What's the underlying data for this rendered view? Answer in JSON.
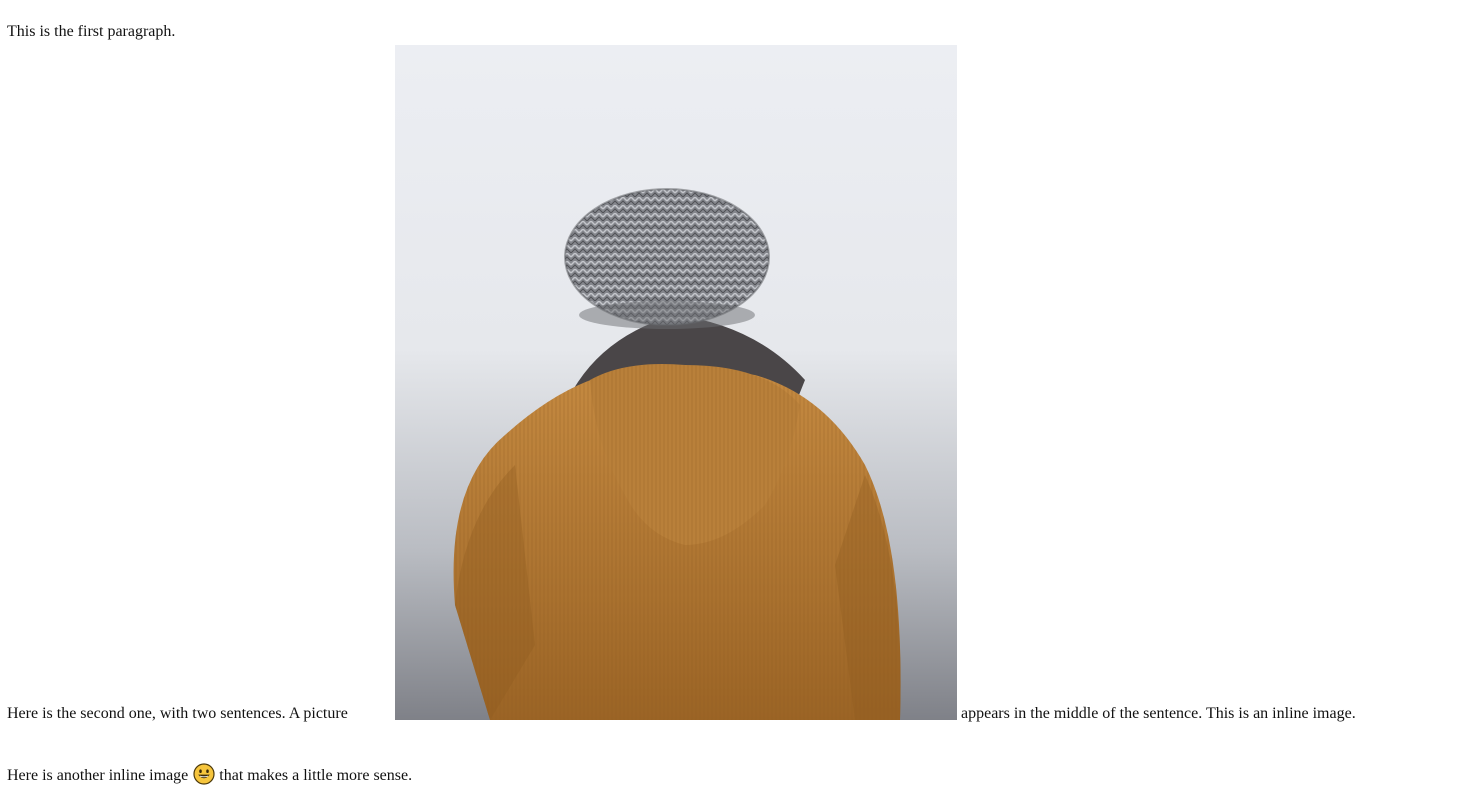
{
  "paragraphs": {
    "first": "This is the first paragraph.",
    "second_before": "Here is the second one, with two sentences. A picture",
    "second_after": "appears in the middle of the sentence. This is an inline image.",
    "third_before": "Here is another inline image",
    "third_after": "that makes a little more sense."
  },
  "images": {
    "photo_icon": "person-in-beanie-photo",
    "emoji_icon": "grinning-face-emoji-icon"
  },
  "colors": {
    "jacket": "#b47a33",
    "beanie": "#8a8b90",
    "sky": "#e9ebf0",
    "emoji": "#f6c53d"
  }
}
